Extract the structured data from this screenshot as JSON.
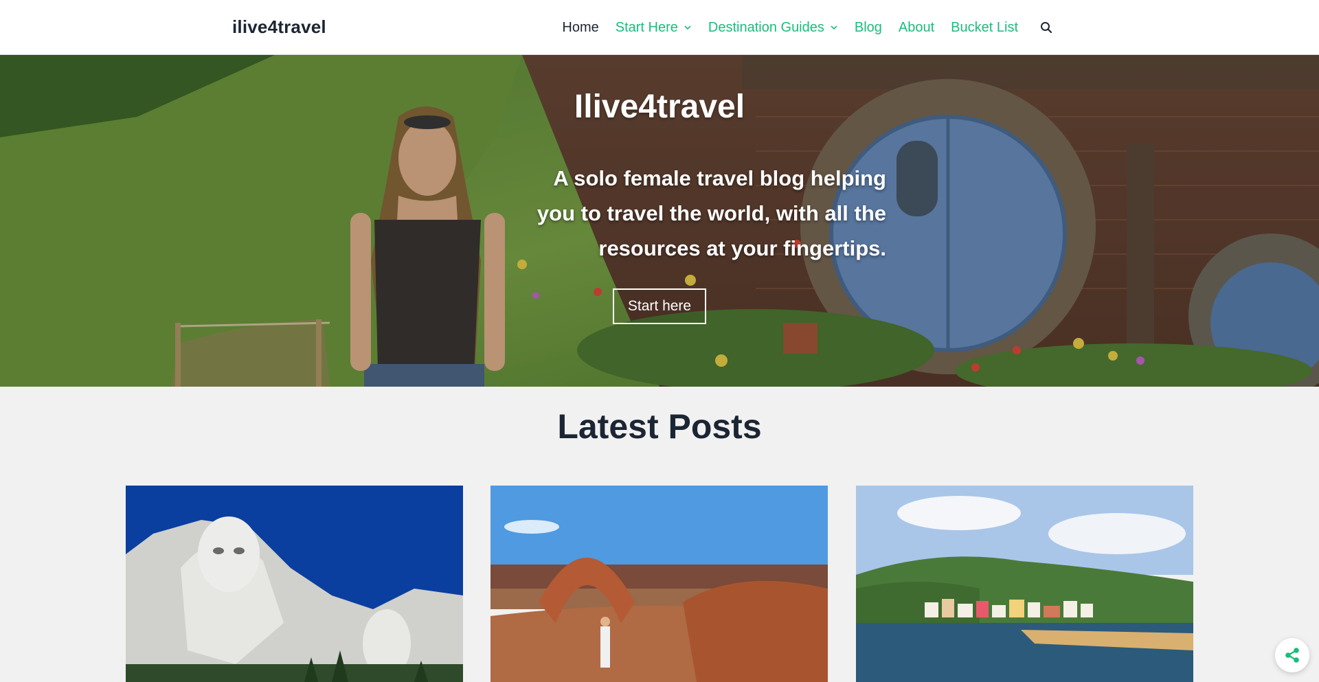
{
  "header": {
    "site_title": "ilive4travel",
    "nav": [
      {
        "label": "Home",
        "has_dropdown": false
      },
      {
        "label": "Start Here",
        "has_dropdown": true
      },
      {
        "label": "Destination Guides",
        "has_dropdown": true
      },
      {
        "label": "Blog",
        "has_dropdown": false
      },
      {
        "label": "About",
        "has_dropdown": false
      },
      {
        "label": "Bucket List",
        "has_dropdown": false
      }
    ],
    "search_icon": "search-icon"
  },
  "hero": {
    "title": "Ilive4travel",
    "tagline": "A solo female travel blog helping you to travel the world, with all the resources at your fingertips.",
    "cta_label": "Start here"
  },
  "latest_posts": {
    "heading": "Latest Posts",
    "cards": [
      {
        "image": "mount-rushmore-photo"
      },
      {
        "image": "delicate-arch-photo"
      },
      {
        "image": "coastal-village-photo"
      }
    ]
  },
  "share": {
    "icon": "share-icon"
  },
  "colors": {
    "accent": "#1abc7b",
    "text_dark": "#1c2533",
    "header_bg": "#ffffff",
    "page_bg": "#f1f1f1"
  }
}
